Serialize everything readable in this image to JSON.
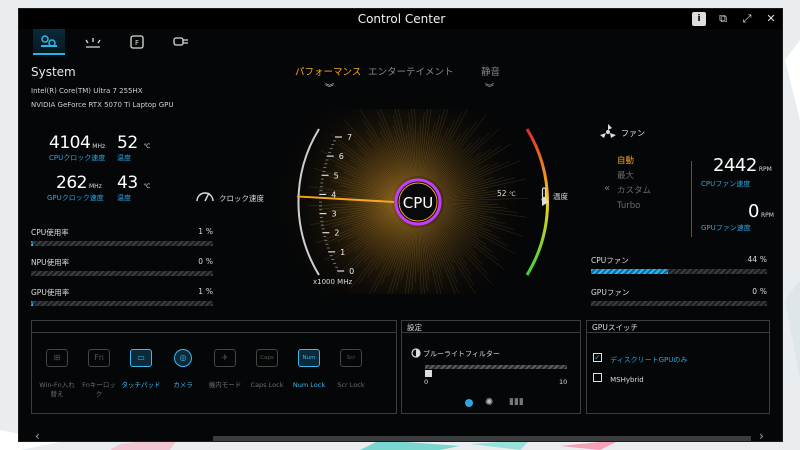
{
  "window": {
    "title": "Control Center"
  },
  "titlebar": {
    "icons": [
      "info-icon",
      "restore-icon",
      "fullscreen-icon",
      "close-icon"
    ]
  },
  "nav": {
    "icons": [
      "system-monitor-icon",
      "lighting-icon",
      "fn-key-icon",
      "connection-icon"
    ],
    "active_index": 0
  },
  "system": {
    "title": "System",
    "cpu_name": "Intel(R) Core(TM) Ultra 7 255HX",
    "gpu_name": "NVIDIA GeForce RTX 5070 Ti Laptop GPU",
    "cpu_clock": {
      "value": "4104",
      "unit": "MHz",
      "label": "CPUクロック速度"
    },
    "cpu_temp": {
      "value": "52",
      "unit": "℃",
      "label": "温度"
    },
    "gpu_clock": {
      "value": "262",
      "unit": "MHz",
      "label": "GPUクロック速度"
    },
    "gpu_temp": {
      "value": "43",
      "unit": "℃",
      "label": "温度"
    },
    "usage": [
      {
        "label": "CPU使用率",
        "value": "1",
        "unit": "%",
        "percent": 1
      },
      {
        "label": "NPU使用率",
        "value": "0",
        "unit": "%",
        "percent": 0
      },
      {
        "label": "GPU使用率",
        "value": "1",
        "unit": "%",
        "percent": 1
      }
    ]
  },
  "modes": {
    "items": [
      "パフォーマンス",
      "エンターテイメント",
      "静音"
    ],
    "active_index": 0
  },
  "gauge": {
    "center_label": "CPU",
    "ticks": [
      "7",
      "6",
      "5",
      "4",
      "3",
      "2",
      "1",
      "0"
    ],
    "unit_label": "x1000 MHz",
    "clock_label": "クロック速度",
    "clock_value_thousands": 4.104,
    "temp_value": "52",
    "temp_unit": "℃",
    "temp_label": "温度",
    "temp_level": 0.52,
    "accent": "#f5a623"
  },
  "fan": {
    "title": "ファン",
    "modes": [
      "自動",
      "最大",
      "カスタム",
      "Turbo"
    ],
    "active_index": 0,
    "cpu_fan": {
      "value": "2442",
      "unit": "RPM",
      "label": "CPUファン速度"
    },
    "gpu_fan": {
      "value": "0",
      "unit": "RPM",
      "label": "GPUファン速度"
    },
    "bars": [
      {
        "label": "CPUファン",
        "value": "44",
        "unit": "%",
        "percent": 44
      },
      {
        "label": "GPUファン",
        "value": "0",
        "unit": "%",
        "percent": 0
      }
    ]
  },
  "keyboard": {
    "items": [
      {
        "label": "Win-Fn入れ替え",
        "icon": "win-fn-swap-icon",
        "on": false
      },
      {
        "label": "Fnキーロック",
        "icon": "fn-lock-icon",
        "on": false
      },
      {
        "label": "タッチパッド",
        "icon": "touchpad-icon",
        "on": true
      },
      {
        "label": "カメラ",
        "icon": "camera-icon",
        "on": true
      },
      {
        "label": "機内モード",
        "icon": "airplane-icon",
        "on": false
      },
      {
        "label": "Caps Lock",
        "icon": "caps-lock-icon",
        "on": false
      },
      {
        "label": "Num Lock",
        "icon": "num-lock-icon",
        "on": true
      },
      {
        "label": "Scr Lock",
        "icon": "scroll-lock-icon",
        "on": false
      }
    ]
  },
  "settings": {
    "title": "設定",
    "bluelight_label": "ブルーライトフィルター",
    "slider_min": "0",
    "slider_max": "10",
    "slider_value": 0
  },
  "gpu_switch": {
    "title": "GPUスイッチ",
    "options": [
      {
        "label": "ディスクリートGPUのみ",
        "checked": true
      },
      {
        "label": "MSHybrid",
        "checked": false
      }
    ]
  },
  "colors": {
    "accent_blue": "#2aa6e0",
    "accent_orange": "#f5a623",
    "active_cyan": "#1fb8e6"
  }
}
